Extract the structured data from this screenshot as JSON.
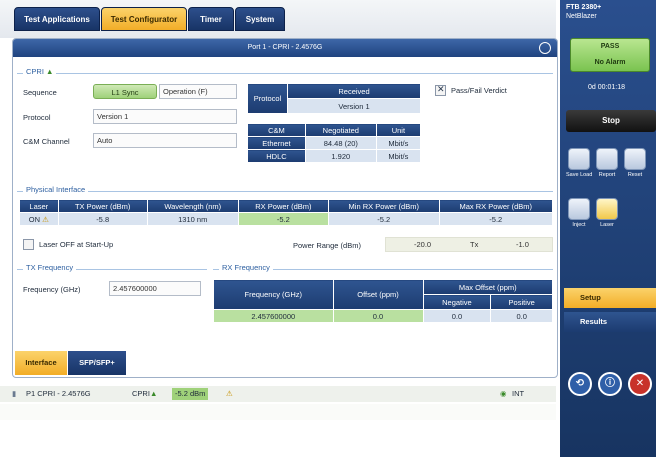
{
  "top_tabs": [
    "Test Applications",
    "Test Configurator",
    "Timer",
    "System"
  ],
  "panel": {
    "title": "Port 1 - CPRI - 2.4576G",
    "cpri": {
      "section_label": "CPRI",
      "sequence_label": "Sequence",
      "sequence_button": "L1 Sync",
      "sequence_state": "Operation (F)",
      "protocol_label": "Protocol",
      "protocol_value": "Version 1",
      "cm_channel_label": "C&M Channel",
      "cm_channel_value": "Auto",
      "received_table": {
        "row_header": "Protocol",
        "col_header": "Received",
        "value": "Version 1"
      },
      "negotiated_table": {
        "headers": [
          "C&M",
          "Negotiated",
          "Unit"
        ],
        "rows": [
          [
            "Ethernet",
            "84.48 (20)",
            "Mbit/s"
          ],
          [
            "HDLC",
            "1.920",
            "Mbit/s"
          ]
        ]
      },
      "passfail_label": "Pass/Fail Verdict"
    },
    "physical": {
      "section_label": "Physical Interface",
      "headers": [
        "Laser",
        "TX Power (dBm)",
        "Wavelength (nm)",
        "RX Power (dBm)",
        "Min RX Power (dBm)",
        "Max RX Power (dBm)"
      ],
      "row": [
        "ON",
        "-5.8",
        "1310 nm",
        "-5.2",
        "-5.2",
        "-5.2"
      ],
      "laser_off_label": "Laser OFF at Start-Up",
      "power_range_label": "Power Range (dBm)",
      "power_range_value": "-20.0",
      "tx_label": "Tx",
      "tx_value": "-1.0"
    },
    "tx_frequency": {
      "section_label": "TX Frequency",
      "freq_label": "Frequency (GHz)",
      "freq_value": "2.457600000"
    },
    "rx_frequency": {
      "section_label": "RX Frequency",
      "headers": [
        "Frequency (GHz)",
        "Offset (ppm)",
        "Max Offset (ppm)"
      ],
      "subheaders": [
        "Negative",
        "Positive"
      ],
      "row": [
        "2.457600000",
        "0.0",
        "0.0",
        "0.0"
      ]
    }
  },
  "bottom_tabs": [
    "Interface",
    "SFP/SFP+"
  ],
  "status": {
    "port": "P1 CPRI - 2.4576G",
    "cpri": "CPRI",
    "power": "-5.2 dBm",
    "int": "INT"
  },
  "sidebar": {
    "device": "FTB 2380+",
    "device_sub": "NetBlazer",
    "verdict": "PASS",
    "alarm": "No Alarm",
    "timer": "0d 00:01:18",
    "stop": "Stop",
    "icons": [
      "Save Load",
      "Report",
      "Reset",
      "Inject",
      "Laser"
    ],
    "setup": "Setup",
    "results": "Results"
  },
  "colors": {
    "accent": "#1f437f",
    "active_tab": "#f2ad27",
    "pass": "#7ac350",
    "cell": "#d9e3f0"
  }
}
